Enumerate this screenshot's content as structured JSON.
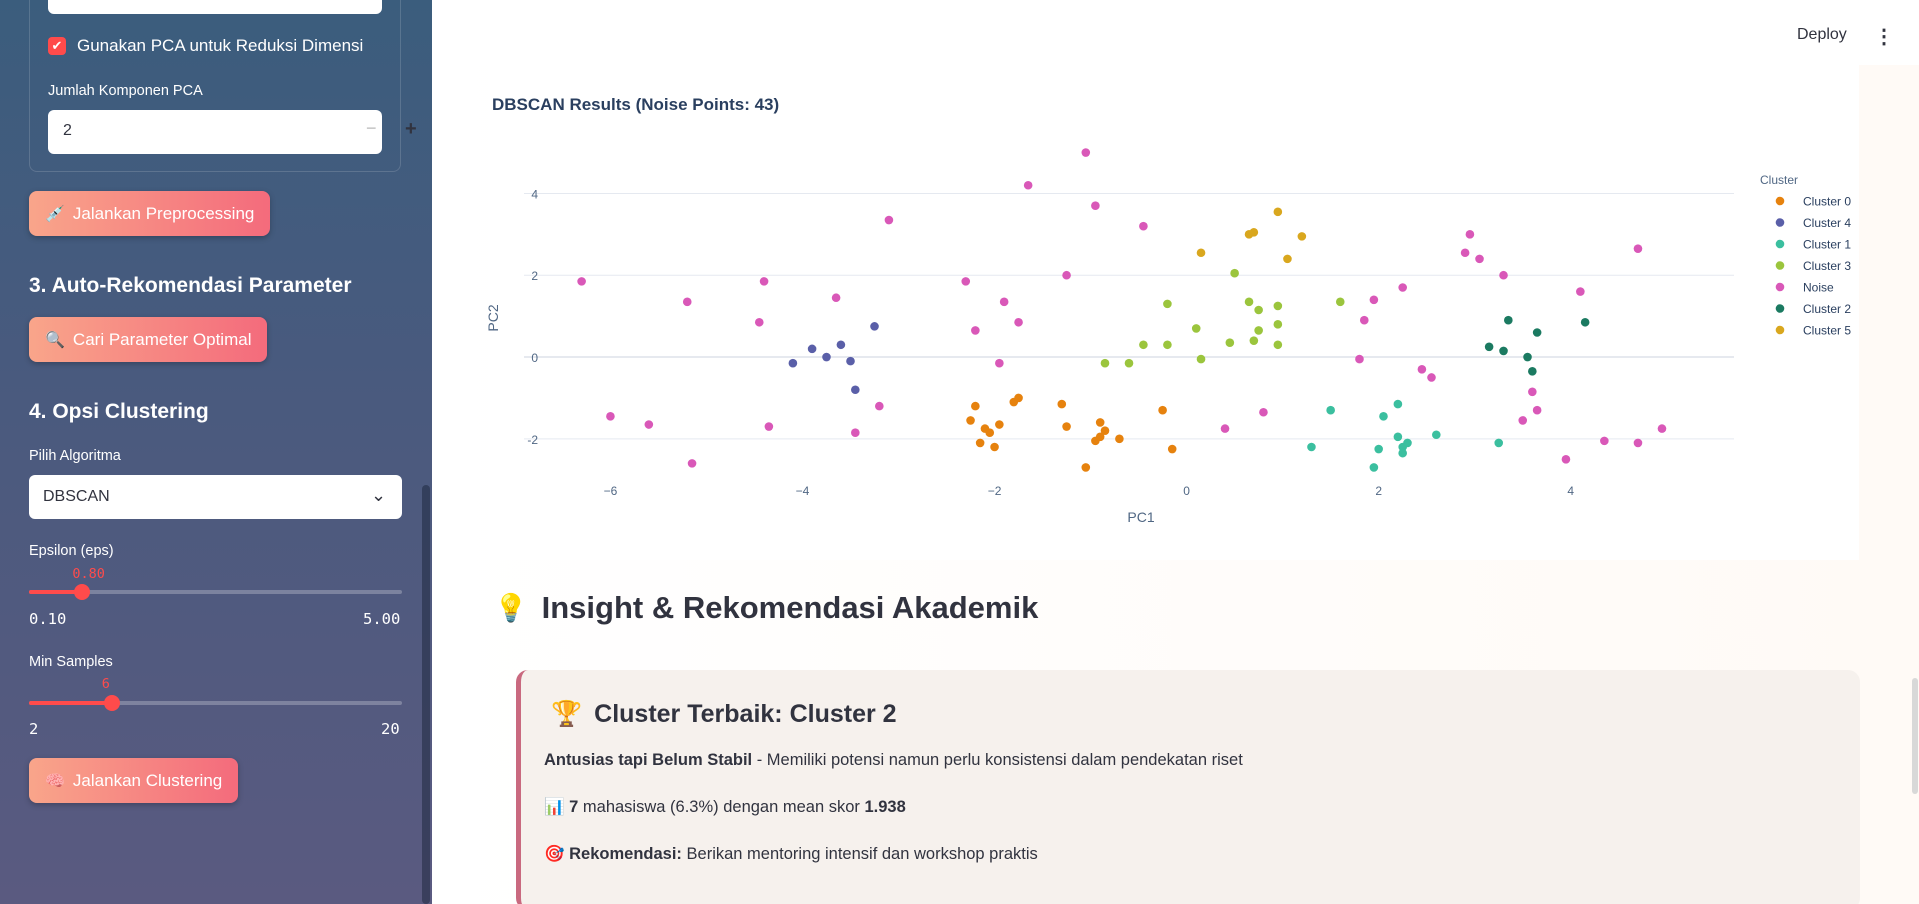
{
  "sidebar": {
    "pca_checkbox_label": "Gunakan PCA untuk Reduksi Dimensi",
    "pca_checkbox_checked": true,
    "pca_components_label": "Jumlah Komponen PCA",
    "pca_components_value": "2",
    "preprocess_button": "Jalankan Preprocessing",
    "section3_title": "3. Auto-Rekomendasi Parameter",
    "optimal_button": "Cari Parameter Optimal",
    "section4_title": "4. Opsi Clustering",
    "algo_label": "Pilih Algoritma",
    "algo_value": "DBSCAN",
    "eps": {
      "label": "Epsilon (eps)",
      "value": "0.80",
      "min": "0.10",
      "max": "5.00",
      "fraction": 0.143
    },
    "min_samples": {
      "label": "Min Samples",
      "value": "6",
      "min": "2",
      "max": "20",
      "fraction": 0.222
    },
    "cluster_button": "Jalankan Clustering"
  },
  "header": {
    "deploy": "Deploy"
  },
  "chart_title": "DBSCAN Results (Noise Points: 43)",
  "chart_data": {
    "type": "scatter",
    "title": "DBSCAN Results (Noise Points: 43)",
    "xlabel": "PC1",
    "ylabel": "PC2",
    "xlim": [
      -6.9,
      5.7
    ],
    "ylim": [
      -3.3,
      5.6
    ],
    "x_ticks": [
      -6,
      -4,
      -2,
      0,
      2,
      4
    ],
    "y_ticks": [
      -2,
      0,
      2,
      4
    ],
    "legend_title": "Cluster",
    "legend_position": "right",
    "series": [
      {
        "name": "Cluster 0",
        "color": "#e6820e",
        "points": [
          [
            -2.25,
            -1.55
          ],
          [
            -2.2,
            -1.2
          ],
          [
            -2.15,
            -2.1
          ],
          [
            -2.1,
            -1.75
          ],
          [
            -2.05,
            -1.85
          ],
          [
            -2.0,
            -2.2
          ],
          [
            -1.95,
            -1.65
          ],
          [
            -1.8,
            -1.1
          ],
          [
            -1.75,
            -1.0
          ],
          [
            -1.3,
            -1.15
          ],
          [
            -1.25,
            -1.7
          ],
          [
            -1.05,
            -2.7
          ],
          [
            -0.95,
            -2.05
          ],
          [
            -0.9,
            -1.95
          ],
          [
            -0.9,
            -1.6
          ],
          [
            -0.85,
            -1.8
          ],
          [
            -0.7,
            -2.0
          ],
          [
            -0.25,
            -1.3
          ],
          [
            -0.15,
            -2.25
          ]
        ]
      },
      {
        "name": "Cluster 4",
        "color": "#5a5fa8",
        "points": [
          [
            -4.1,
            -0.15
          ],
          [
            -3.9,
            0.2
          ],
          [
            -3.75,
            0.0
          ],
          [
            -3.6,
            0.3
          ],
          [
            -3.5,
            -0.1
          ],
          [
            -3.45,
            -0.8
          ],
          [
            -3.25,
            0.75
          ]
        ]
      },
      {
        "name": "Cluster 1",
        "color": "#3bbf9f",
        "points": [
          [
            1.3,
            -2.2
          ],
          [
            1.5,
            -1.3
          ],
          [
            1.95,
            -2.7
          ],
          [
            2.0,
            -2.25
          ],
          [
            2.05,
            -1.45
          ],
          [
            2.2,
            -1.15
          ],
          [
            2.2,
            -1.95
          ],
          [
            2.25,
            -2.2
          ],
          [
            2.25,
            -2.35
          ],
          [
            2.3,
            -2.1
          ],
          [
            2.6,
            -1.9
          ],
          [
            3.25,
            -2.1
          ]
        ]
      },
      {
        "name": "Cluster 3",
        "color": "#9bc53d",
        "points": [
          [
            -0.85,
            -0.15
          ],
          [
            -0.6,
            -0.15
          ],
          [
            -0.45,
            0.3
          ],
          [
            -0.2,
            0.3
          ],
          [
            -0.2,
            1.3
          ],
          [
            0.1,
            0.7
          ],
          [
            0.15,
            -0.05
          ],
          [
            0.45,
            0.35
          ],
          [
            0.5,
            2.05
          ],
          [
            0.65,
            1.35
          ],
          [
            0.7,
            0.4
          ],
          [
            0.75,
            0.65
          ],
          [
            0.75,
            1.15
          ],
          [
            0.95,
            0.3
          ],
          [
            0.95,
            0.8
          ],
          [
            0.95,
            1.25
          ],
          [
            1.6,
            1.35
          ]
        ]
      },
      {
        "name": "Noise",
        "color": "#d958b8",
        "points": [
          [
            -6.3,
            1.85
          ],
          [
            -6.0,
            -1.45
          ],
          [
            -5.6,
            -1.65
          ],
          [
            -5.2,
            1.35
          ],
          [
            -5.15,
            -2.6
          ],
          [
            -4.45,
            0.85
          ],
          [
            -4.4,
            1.85
          ],
          [
            -4.35,
            -1.7
          ],
          [
            -3.65,
            1.45
          ],
          [
            -3.45,
            -1.85
          ],
          [
            -3.2,
            -1.2
          ],
          [
            -3.1,
            3.35
          ],
          [
            -2.3,
            1.85
          ],
          [
            -2.2,
            0.65
          ],
          [
            -1.95,
            -0.15
          ],
          [
            -1.9,
            1.35
          ],
          [
            -1.75,
            0.85
          ],
          [
            -1.65,
            4.2
          ],
          [
            -1.25,
            2.0
          ],
          [
            -1.05,
            5.0
          ],
          [
            -0.95,
            3.7
          ],
          [
            -0.45,
            3.2
          ],
          [
            0.4,
            -1.75
          ],
          [
            0.8,
            -1.35
          ],
          [
            1.8,
            -0.05
          ],
          [
            1.85,
            0.9
          ],
          [
            1.95,
            1.4
          ],
          [
            2.25,
            1.7
          ],
          [
            2.45,
            -0.3
          ],
          [
            2.55,
            -0.5
          ],
          [
            2.9,
            2.55
          ],
          [
            2.95,
            3.0
          ],
          [
            3.05,
            2.4
          ],
          [
            3.3,
            2.0
          ],
          [
            3.5,
            -1.55
          ],
          [
            3.6,
            -0.85
          ],
          [
            3.65,
            -1.3
          ],
          [
            3.95,
            -2.5
          ],
          [
            4.1,
            1.6
          ],
          [
            4.35,
            -2.05
          ],
          [
            4.7,
            -2.1
          ],
          [
            4.7,
            2.65
          ],
          [
            4.95,
            -1.75
          ]
        ]
      },
      {
        "name": "Cluster 2",
        "color": "#1b7a61",
        "points": [
          [
            3.15,
            0.25
          ],
          [
            3.3,
            0.15
          ],
          [
            3.35,
            0.9
          ],
          [
            3.55,
            0.0
          ],
          [
            3.6,
            -0.35
          ],
          [
            3.65,
            0.6
          ],
          [
            4.15,
            0.85
          ]
        ]
      },
      {
        "name": "Cluster 5",
        "color": "#d9a71e",
        "points": [
          [
            0.15,
            2.55
          ],
          [
            0.65,
            3.0
          ],
          [
            0.7,
            3.05
          ],
          [
            0.95,
            3.55
          ],
          [
            1.05,
            2.4
          ],
          [
            1.2,
            2.95
          ]
        ]
      }
    ]
  },
  "insight": {
    "heading_icon": "bulb-icon",
    "heading": "Insight & Rekomendasi Akademik",
    "card_title": "Cluster Terbaik: Cluster 2",
    "profile_bold": "Antusias tapi Belum Stabil",
    "profile_rest": " - Memiliki potensi namun perlu konsistensi dalam pendekatan riset",
    "count_bold": "7",
    "count_mid": " mahasiswa (6.3%) dengan mean skor ",
    "mean_bold": "1.938",
    "rec_bold": "Rekomendasi:",
    "rec_rest": " Berikan mentoring intensif dan workshop praktis"
  }
}
